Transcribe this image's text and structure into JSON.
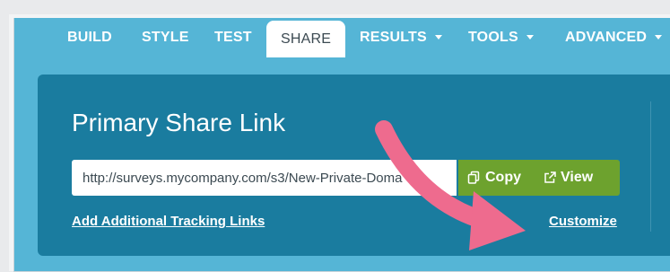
{
  "nav": {
    "tabs": [
      {
        "label": "BUILD",
        "dropdown": false
      },
      {
        "label": "STYLE",
        "dropdown": false
      },
      {
        "label": "TEST",
        "dropdown": false
      },
      {
        "label": "SHARE",
        "dropdown": false,
        "active": true
      },
      {
        "label": "RESULTS",
        "dropdown": true
      },
      {
        "label": "TOOLS",
        "dropdown": true
      },
      {
        "label": "ADVANCED",
        "dropdown": true
      }
    ]
  },
  "share": {
    "title": "Primary Share Link",
    "url_value": "http://surveys.mycompany.com/s3/New-Private-Doma",
    "copy_label": "Copy",
    "view_label": "View",
    "tracking_link": "Add Additional Tracking Links",
    "customize_link": "Customize"
  },
  "colors": {
    "nav_background": "#55b5d6",
    "panel_background": "#1a7c9f",
    "button_green": "#6da22e",
    "annotation_arrow": "#ee6b8e"
  },
  "icons": {
    "copy": "copy-icon",
    "view": "external-link-icon",
    "caret": "caret-down-icon",
    "annotation": "pointer-arrow-icon"
  }
}
